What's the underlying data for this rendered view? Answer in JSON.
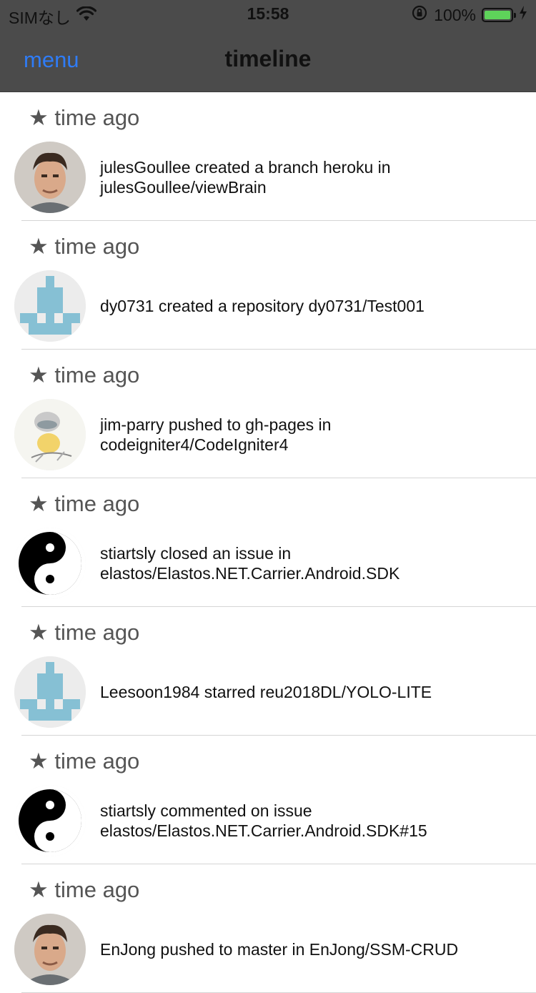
{
  "status_bar": {
    "carrier": "SIMなし",
    "time": "15:58",
    "battery_percent": "100%",
    "battery_level": 1.0,
    "battery_color": "#5ed35a"
  },
  "nav": {
    "menu_label": "menu",
    "title": "timeline",
    "accent_color": "#2f7cf6"
  },
  "events": [
    {
      "time_label": "★ time ago",
      "text": "julesGoullee created a branch heroku in julesGoullee/viewBrain",
      "avatar_icon": "photo-avatar-icon"
    },
    {
      "time_label": "★ time ago",
      "text": "dy0731 created a repository dy0731/Test001",
      "avatar_icon": "identicon-avatar-icon"
    },
    {
      "time_label": "★ time ago",
      "text": "jim-parry pushed to gh-pages in codeigniter4/CodeIgniter4",
      "avatar_icon": "cartoon-avatar-icon"
    },
    {
      "time_label": "★ time ago",
      "text": "stiartsly closed an issue in elastos/Elastos.NET.Carrier.Android.SDK",
      "avatar_icon": "yin-yang-avatar-icon"
    },
    {
      "time_label": "★ time ago",
      "text": "Leesoon1984 starred reu2018DL/YOLO-LITE",
      "avatar_icon": "identicon-avatar-icon"
    },
    {
      "time_label": "★ time ago",
      "text": "stiartsly commented on issue elastos/Elastos.NET.Carrier.Android.SDK#15",
      "avatar_icon": "yin-yang-avatar-icon"
    },
    {
      "time_label": "★ time ago",
      "text": "EnJong pushed to master in EnJong/SSM-CRUD",
      "avatar_icon": "photo-avatar-icon"
    }
  ]
}
